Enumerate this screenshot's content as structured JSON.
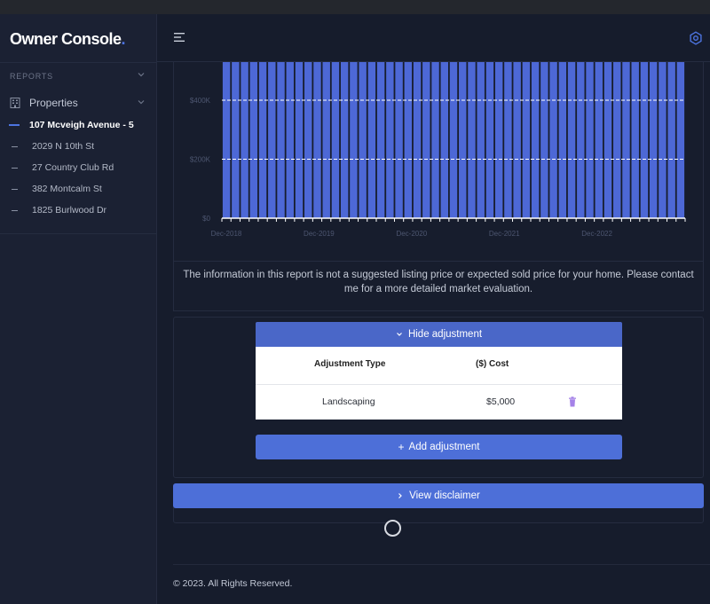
{
  "app": {
    "name": "Owner Console",
    "logo_dot": "."
  },
  "sidebar": {
    "section_label": "REPORTS",
    "properties_label": "Properties",
    "items": [
      {
        "label": "107 Mcveigh Avenue - 5",
        "active": true
      },
      {
        "label": "2029 N 10th St",
        "active": false
      },
      {
        "label": "27 Country Club Rd",
        "active": false
      },
      {
        "label": "382 Montcalm St",
        "active": false
      },
      {
        "label": "1825 Burlwood Dr",
        "active": false
      }
    ]
  },
  "header": {
    "menu_icon": "hamburger-icon",
    "settings_icon": "gear-icon"
  },
  "chart_data": {
    "type": "bar",
    "ylim": [
      0,
      500000
    ],
    "y_ticks": [
      {
        "value": 0,
        "label": "$0"
      },
      {
        "value": 200000,
        "label": "$200K"
      },
      {
        "value": 400000,
        "label": "$400K"
      }
    ],
    "x_ticks": [
      "Dec-2018",
      "Dec-2019",
      "Dec-2020",
      "Dec-2021",
      "Dec-2022"
    ],
    "bar_count": 51,
    "bar_value": 530000,
    "bar_color": "#4d68d6",
    "grid": true
  },
  "report": {
    "disclaimer": "The information in this report is not a suggested listing price or expected sold price for your home. Please contact me for a more detailed market evaluation."
  },
  "adjustments": {
    "toggle_label": "Hide adjustment",
    "col_type": "Adjustment Type",
    "col_cost": "($) Cost",
    "rows": [
      {
        "type": "Landscaping",
        "cost": "$5,000"
      }
    ],
    "add_label": "Add adjustment"
  },
  "view_disclaimer_label": "View disclaimer",
  "footer": {
    "text": "© 2023. All Rights Reserved."
  },
  "colors": {
    "accent": "#4d6fd8",
    "background": "#161c2c",
    "trash": "#a582e8"
  }
}
